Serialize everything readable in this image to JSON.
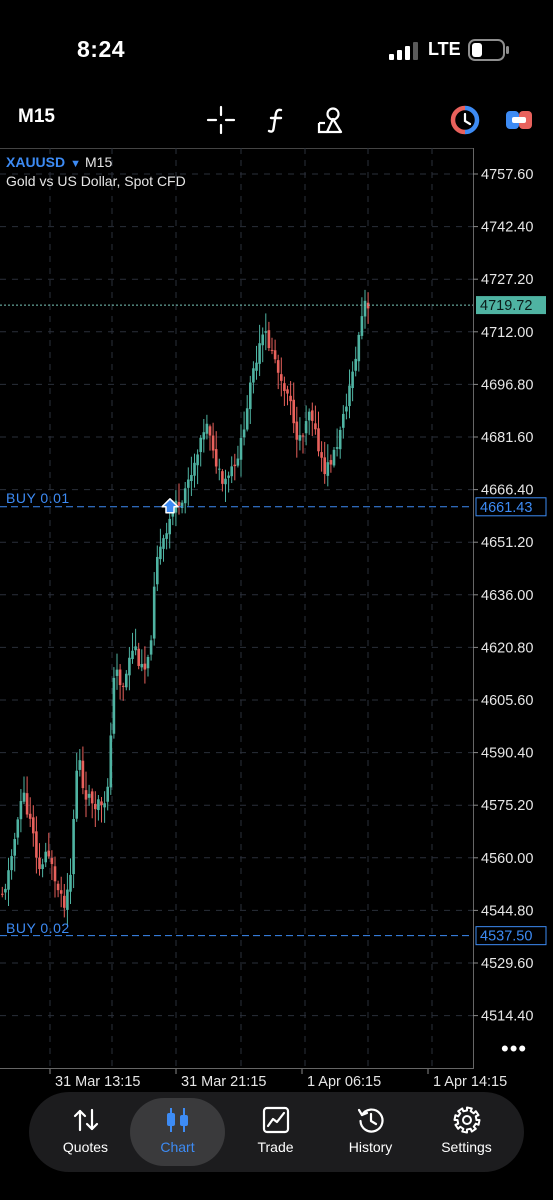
{
  "status_bar": {
    "time": "8:24",
    "network": "LTE"
  },
  "toolbar": {
    "timeframe": "M15",
    "icons": [
      "crosshair-icon",
      "indicator-icon",
      "objects-icon",
      "trade-signal-icon",
      "one-click-trading-icon"
    ]
  },
  "chart": {
    "symbol": "XAUUSD",
    "symbol_arrow": "▼",
    "timeframe": "M15",
    "description": "Gold vs US Dollar, Spot CFD",
    "price_labels": [
      "4757.60",
      "4742.40",
      "4727.20",
      "4712.00",
      "4696.80",
      "4681.60",
      "4666.40",
      "4651.20",
      "4636.00",
      "4620.80",
      "4605.60",
      "4590.40",
      "4575.20",
      "4560.00",
      "4544.80",
      "4529.60",
      "4514.40"
    ],
    "time_labels": [
      "31 Mar 13:15",
      "31 Mar 21:15",
      "1 Apr 06:15",
      "1 Apr 14:15"
    ],
    "current_price": "4719.72",
    "orders": [
      {
        "label": "BUY 0.01",
        "price": "4661.43"
      },
      {
        "label": "BUY 0.02",
        "price": "4537.50"
      }
    ],
    "more": "•••",
    "colors": {
      "bull": "#4fb3a2",
      "bear": "#e8615c",
      "order": "#3d8bf4",
      "grid": "#2a2f3a",
      "current_price_bg": "#4fb3a2"
    }
  },
  "chart_data": {
    "type": "candlestick",
    "symbol": "XAUUSD",
    "timeframe": "M15",
    "ylim": [
      4499.2,
      4772.8
    ],
    "x_ticks": [
      "31 Mar 13:15",
      "31 Mar 21:15",
      "1 Apr 06:15",
      "1 Apr 14:15"
    ],
    "current_price": 4719.72,
    "buy_signal_price": 4661.43,
    "close_path": [
      [
        1,
        4549
      ],
      [
        10,
        4558
      ],
      [
        18,
        4576
      ],
      [
        23,
        4578
      ],
      [
        32,
        4566
      ],
      [
        38,
        4556
      ],
      [
        44,
        4562
      ],
      [
        50,
        4558
      ],
      [
        58,
        4549
      ],
      [
        64,
        4545
      ],
      [
        70,
        4556
      ],
      [
        74,
        4582
      ],
      [
        78,
        4590
      ],
      [
        82,
        4580
      ],
      [
        88,
        4577
      ],
      [
        94,
        4576
      ],
      [
        100,
        4576
      ],
      [
        106,
        4578
      ],
      [
        110,
        4596
      ],
      [
        112,
        4613
      ],
      [
        116,
        4615
      ],
      [
        120,
        4606
      ],
      [
        124,
        4612
      ],
      [
        128,
        4617
      ],
      [
        133,
        4622
      ],
      [
        138,
        4616
      ],
      [
        142,
        4613
      ],
      [
        148,
        4617
      ],
      [
        152,
        4634
      ],
      [
        156,
        4646
      ],
      [
        160,
        4652
      ],
      [
        164,
        4654
      ],
      [
        168,
        4658
      ],
      [
        172,
        4660
      ],
      [
        176,
        4663
      ],
      [
        180,
        4664
      ],
      [
        184,
        4667
      ],
      [
        188,
        4668
      ],
      [
        192,
        4672
      ],
      [
        196,
        4676
      ],
      [
        200,
        4680
      ],
      [
        204,
        4686
      ],
      [
        208,
        4682
      ],
      [
        212,
        4676
      ],
      [
        216,
        4674
      ],
      [
        220,
        4670
      ],
      [
        224,
        4670
      ],
      [
        228,
        4672
      ],
      [
        232,
        4674
      ],
      [
        236,
        4676
      ],
      [
        240,
        4680
      ],
      [
        244,
        4688
      ],
      [
        248,
        4694
      ],
      [
        252,
        4700
      ],
      [
        256,
        4706
      ],
      [
        260,
        4712
      ],
      [
        264,
        4714
      ],
      [
        268,
        4706
      ],
      [
        272,
        4706
      ],
      [
        276,
        4701
      ],
      [
        280,
        4696
      ],
      [
        284,
        4694
      ],
      [
        288,
        4692
      ],
      [
        292,
        4688
      ],
      [
        296,
        4682
      ],
      [
        300,
        4680
      ],
      [
        304,
        4684
      ],
      [
        308,
        4688
      ],
      [
        312,
        4684
      ],
      [
        316,
        4680
      ],
      [
        320,
        4676
      ],
      [
        324,
        4672
      ],
      [
        328,
        4674
      ],
      [
        332,
        4676
      ],
      [
        336,
        4680
      ],
      [
        340,
        4684
      ],
      [
        344,
        4690
      ],
      [
        348,
        4696
      ],
      [
        352,
        4700
      ],
      [
        356,
        4708
      ],
      [
        360,
        4716
      ],
      [
        364,
        4722
      ],
      [
        367,
        4719.72
      ]
    ]
  },
  "tabs": [
    {
      "id": "quotes",
      "label": "Quotes",
      "icon": "quotes-icon"
    },
    {
      "id": "chart",
      "label": "Chart",
      "icon": "chart-icon",
      "active": true
    },
    {
      "id": "trade",
      "label": "Trade",
      "icon": "trade-icon"
    },
    {
      "id": "history",
      "label": "History",
      "icon": "history-icon"
    },
    {
      "id": "settings",
      "label": "Settings",
      "icon": "settings-icon"
    }
  ]
}
